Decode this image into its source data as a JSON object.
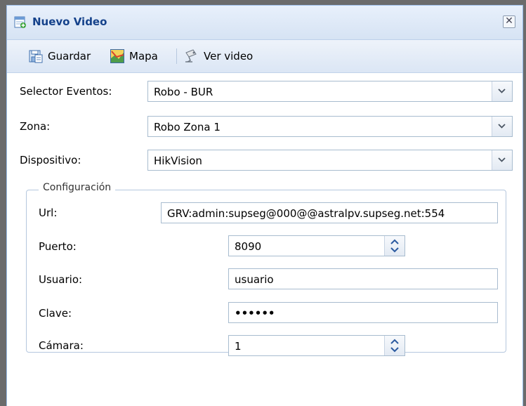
{
  "window": {
    "title": "Nuevo Video",
    "close_glyph": "✕"
  },
  "toolbar": {
    "save_label": "Guardar",
    "map_label": "Mapa",
    "video_label": "Ver video",
    "save_icon": "save-icon",
    "map_icon": "map-icon",
    "video_icon": "camera-icon"
  },
  "form": {
    "selector_label": "Selector Eventos:",
    "selector_value": "Robo - BUR",
    "zona_label": "Zona:",
    "zona_value": "Robo Zona 1",
    "dispositivo_label": "Dispositivo:",
    "dispositivo_value": "HikVision"
  },
  "config": {
    "legend": "Configuración",
    "url_label": "Url:",
    "url_value": "GRV:admin:supseg@000@@astralpv.supseg.net:554",
    "puerto_label": "Puerto:",
    "puerto_value": "8090",
    "usuario_label": "Usuario:",
    "usuario_value": "usuario",
    "clave_label": "Clave:",
    "clave_value": "••••••",
    "camara_label": "Cámara:",
    "camara_value": "1"
  },
  "colors": {
    "title_text": "#15428b",
    "border": "#99bbe8",
    "field_border": "#a8bccf"
  }
}
